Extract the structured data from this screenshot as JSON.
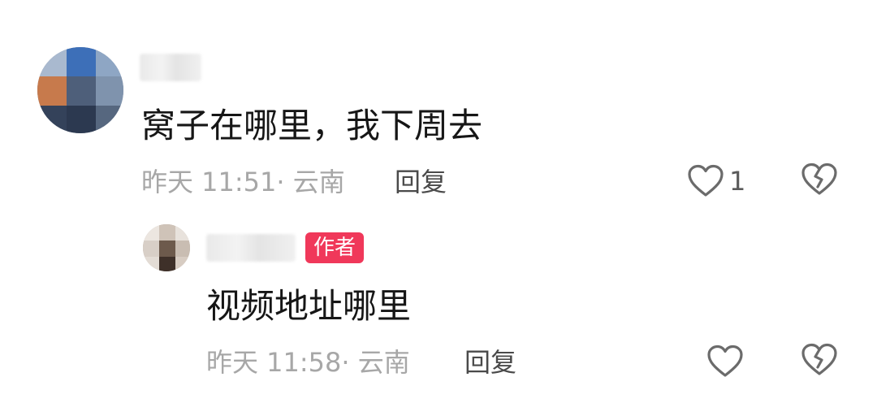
{
  "comments": [
    {
      "text": "窝子在哪里，我下周去",
      "time": "昨天 11:51",
      "location": "· 云南",
      "reply_label": "回复",
      "likes": "1",
      "like_icon": "heart-outline-icon",
      "dislike_icon": "broken-heart-icon"
    }
  ],
  "reply": {
    "badge": "作者",
    "text": "视频地址哪里",
    "time": "昨天 11:58",
    "location": "· 云南",
    "reply_label": "回复",
    "like_icon": "heart-outline-icon",
    "dislike_icon": "broken-heart-icon"
  },
  "colors": {
    "badge_bg": "#f0385a",
    "icon_stroke": "#6b6b6b"
  }
}
